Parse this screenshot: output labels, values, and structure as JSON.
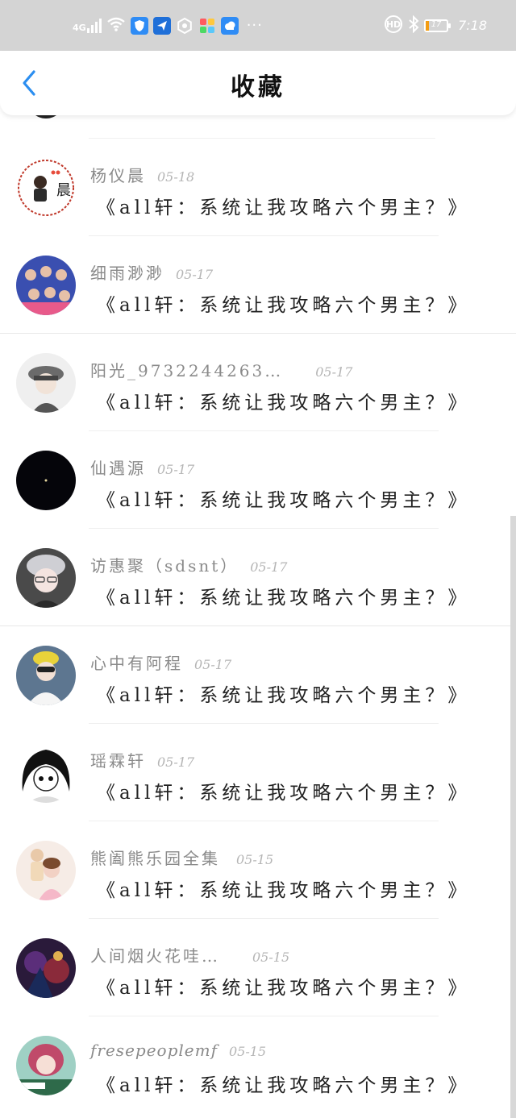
{
  "status_bar": {
    "network": "4G",
    "time": "7:18",
    "battery_level": "17",
    "more_indicator": "···",
    "icons": [
      "signal-icon",
      "wifi-icon",
      "shield-app-icon",
      "paper-plane-app-icon",
      "camera-app-icon",
      "photos-app-icon",
      "weather-app-icon",
      "hd-icon",
      "bluetooth-icon",
      "battery-icon"
    ]
  },
  "header": {
    "title": "收藏",
    "back_icon": "chevron-left-icon"
  },
  "favorites": [
    {
      "username": "杨仪晨",
      "date": "05-18",
      "book_title": "《all轩：系统让我攻略六个男主？》"
    },
    {
      "username": "细雨渺渺",
      "date": "05-17",
      "book_title": "《all轩：系统让我攻略六个男主？》"
    },
    {
      "username": "阳光_9732244263…",
      "date": "05-17",
      "book_title": "《all轩：系统让我攻略六个男主？》"
    },
    {
      "username": "仙遇源",
      "date": "05-17",
      "book_title": "《all轩：系统让我攻略六个男主？》"
    },
    {
      "username": "访惠聚（sdsnt）",
      "date": "05-17",
      "book_title": "《all轩：系统让我攻略六个男主？》"
    },
    {
      "username": "心中有阿程",
      "date": "05-17",
      "book_title": "《all轩：系统让我攻略六个男主？》"
    },
    {
      "username": "瑶霖轩",
      "date": "05-17",
      "book_title": "《all轩：系统让我攻略六个男主？》"
    },
    {
      "username": "熊阖熊乐园全集",
      "date": "05-15",
      "book_title": "《all轩：系统让我攻略六个男主？》"
    },
    {
      "username": "人间烟火花哇…",
      "date": "05-15",
      "book_title": "《all轩：系统让我攻略六个男主？》"
    },
    {
      "username": "fresepeoplemf",
      "date": "05-15",
      "book_title": "《all轩：系统让我攻略六个男主？》"
    }
  ],
  "colors": {
    "status_bar_bg": "#d4d4d4",
    "accent_blue": "#2b8ef0",
    "username_gray": "#8a8a8a",
    "date_gray": "#b5b5b5",
    "title_dark": "#222222"
  }
}
